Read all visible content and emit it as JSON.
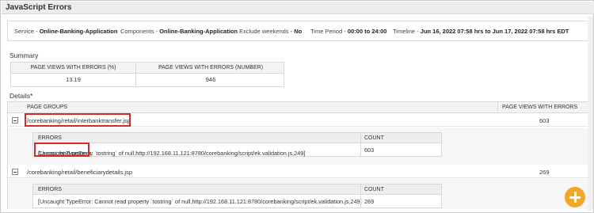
{
  "window": {
    "title": "JavaScript Errors"
  },
  "filters": {
    "service_label": "Service - ",
    "service_value": "Online-Banking-Application",
    "components_label": "Components - ",
    "components_value": "Online-Banking-Application",
    "exclude_label": "Exclude weekends - ",
    "exclude_value": "No",
    "time_label": "Time Period - ",
    "time_value": "00:00 to 24:00",
    "timeline_label": "Timeline - ",
    "timeline_value": "Jun 16, 2022 07:58 hrs to Jun 17, 2022 07:58 hrs EDT"
  },
  "summary": {
    "label": "Summary",
    "columns": [
      "PAGE VIEWS WITH ERRORS (%)",
      "PAGE VIEWS WITH ERRORS (NUMBER)"
    ],
    "values": [
      "13.19",
      "946"
    ]
  },
  "details": {
    "label": "Details",
    "asterisk": "*",
    "columns": [
      "PAGE GROUPS",
      "PAGE VIEWS WITH ERRORS"
    ],
    "groups": [
      {
        "path": "/corebanking/retail/interbanktransfer.jsp",
        "count": "603",
        "error_columns": [
          "ERRORS",
          "COUNT"
        ],
        "error_prefix": "[Uncaught TypeError:",
        "error_rest": " Cannot read property `tostring` of null,http://192.168.11.121:8780/corebanking/script/ek.validation.js,249]",
        "error_count": "603"
      },
      {
        "path": "/corebanking/retail/beneficiarydetails.jsp",
        "count": "269",
        "error_columns": [
          "ERRORS",
          "COUNT"
        ],
        "error_text": "[Uncaught TypeError: Cannot read property `tostring` of null,http://192.168.11.121:8780/corebanking/script/ek.validation.js,249]",
        "error_count": "269"
      }
    ]
  },
  "fab": {
    "icon": "plus-icon",
    "color": "#f5a623"
  },
  "highlight_color": "#d42a2a"
}
